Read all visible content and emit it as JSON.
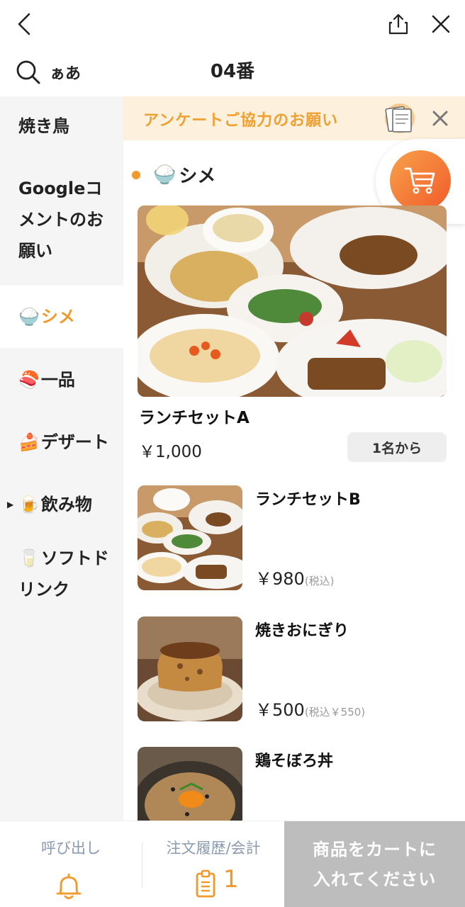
{
  "header": {
    "table_number": "04番",
    "language_label": "ぁあ"
  },
  "sidebar": {
    "items": [
      {
        "label": "焼き鳥",
        "emoji": ""
      },
      {
        "label": "Googleコメントのお願い",
        "line1": "Googleコ",
        "line2": "メントのお",
        "line3": "願い",
        "emoji": ""
      },
      {
        "label": "シメ",
        "emoji": "🍚",
        "active": true
      },
      {
        "label": "一品",
        "emoji": "🍣"
      },
      {
        "label": "デザート",
        "emoji": "🍰"
      },
      {
        "label": "飲み物",
        "emoji": "🍺",
        "expandable": true
      },
      {
        "label": "ソフトドリンク",
        "line1": "ソフトド",
        "line2": "リンク",
        "emoji": "🥛"
      }
    ]
  },
  "survey": {
    "text": "アンケートご協力のお願い"
  },
  "section": {
    "emoji": "🍚",
    "title": "シメ"
  },
  "featured": {
    "name": "ランチセットA",
    "price": "￥1,000",
    "min_order": "1名から"
  },
  "items": [
    {
      "name": "ランチセットB",
      "price": "￥980",
      "tax_note": "(税込)"
    },
    {
      "name": "焼きおにぎり",
      "price": "￥500",
      "tax_note": "(税込￥550)"
    },
    {
      "name": "鶏そぼろ丼",
      "price": "",
      "tax_note": ""
    }
  ],
  "bottom": {
    "call_label": "呼び出し",
    "history_label": "注文履歴/会計",
    "history_count": "1",
    "cart_line1": "商品をカートに",
    "cart_line2": "入れてください"
  },
  "colors": {
    "accent": "#f19a2b",
    "survey_bg": "#fdf0dd",
    "sidebar_bg": "#f5f5f5",
    "cta_disabled": "#bdbdbd",
    "muted_text": "#8a9ab0"
  }
}
